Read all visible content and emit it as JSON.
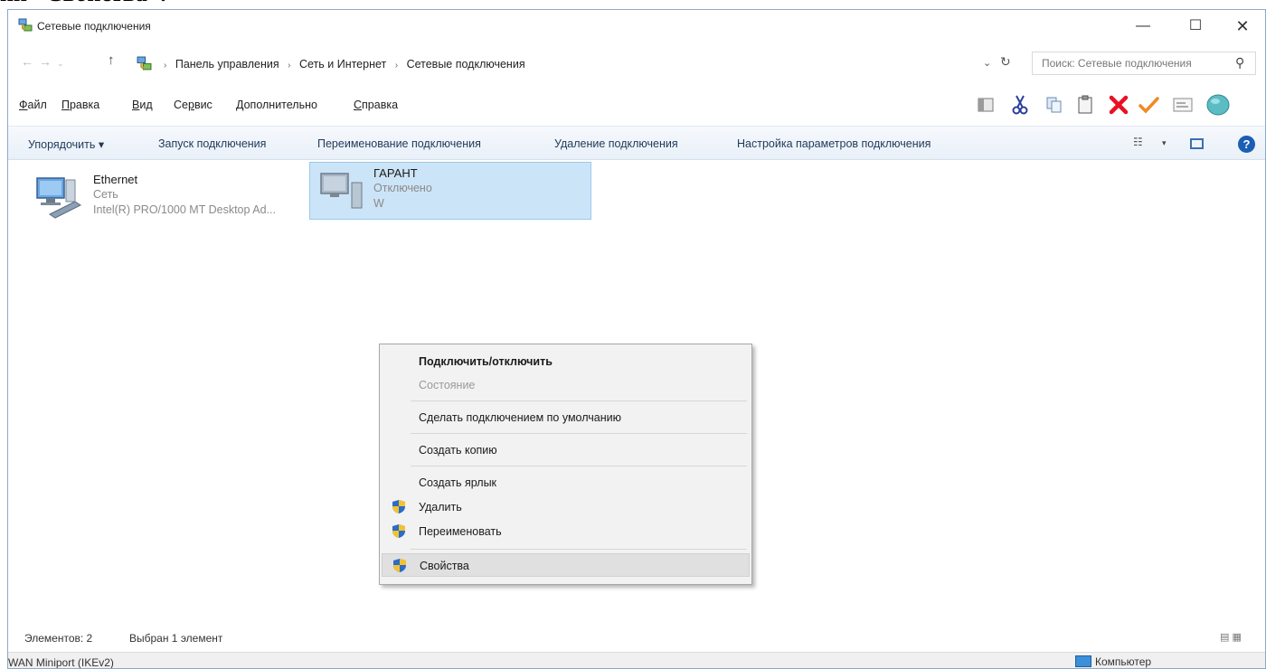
{
  "page_fragment": "ии\" Свойства\".",
  "window": {
    "title": "Сетевые подключения",
    "controls": {
      "minimize": "—",
      "maximize": "☐",
      "close": "✕"
    }
  },
  "address": {
    "crumbs": [
      "Панель управления",
      "Сеть и Интернет",
      "Сетевые подключения"
    ],
    "search_placeholder": "Поиск: Сетевые подключения"
  },
  "menubar": {
    "items": [
      {
        "u": "Ф",
        "rest": "айл"
      },
      {
        "u": "П",
        "rest": "равка"
      },
      {
        "u": "В",
        "rest": "ид"
      },
      {
        "pre": "Се",
        "u": "р",
        "rest": "вис"
      },
      {
        "u": "Д",
        "rest": "ополнительно"
      },
      {
        "u": "С",
        "rest": "правка"
      }
    ],
    "toolbar_icons": [
      "panel-icon",
      "cut-icon",
      "copy-icon",
      "paste-icon",
      "delete-x-icon",
      "checkmark-icon",
      "properties-icon",
      "globe-icon"
    ]
  },
  "cmdbar": {
    "organize": "Упорядочить ▾",
    "start": "Запуск подключения",
    "rename": "Переименование подключения",
    "delete": "Удаление подключения",
    "settings": "Настройка параметров подключения",
    "views_glyph": "☷",
    "views_arrow": "▾",
    "help": "?"
  },
  "connections": [
    {
      "name": "Ethernet",
      "line1": "Сеть",
      "line2": "Intel(R) PRO/1000 MT Desktop Ad..."
    },
    {
      "name": "ГАРАНТ",
      "line1": "Отключено",
      "line2": "W"
    }
  ],
  "context_menu": [
    {
      "label": "Подключить/отключить",
      "bold": true
    },
    {
      "label": "Состояние",
      "disabled": true
    },
    {
      "label": "Сделать подключением по умолчанию"
    },
    {
      "label": "Создать копию"
    },
    {
      "label": "Создать ярлык"
    },
    {
      "label": "Удалить",
      "shield": true
    },
    {
      "label": "Переименовать",
      "shield": true
    },
    {
      "label": "Свойства",
      "shield": true,
      "hover": true
    }
  ],
  "statusbar": {
    "count": "Элементов: 2",
    "selected": "Выбран 1 элемент"
  },
  "bottombar": {
    "left": "WAN Miniport (IKEv2)",
    "right": "Компьютер"
  },
  "colors": {
    "selection_bg": "#cce4f7",
    "selection_border": "#99c9ef",
    "accent": "#1a5fb4",
    "delete_red": "#e81123",
    "check_orange": "#f08a24"
  }
}
